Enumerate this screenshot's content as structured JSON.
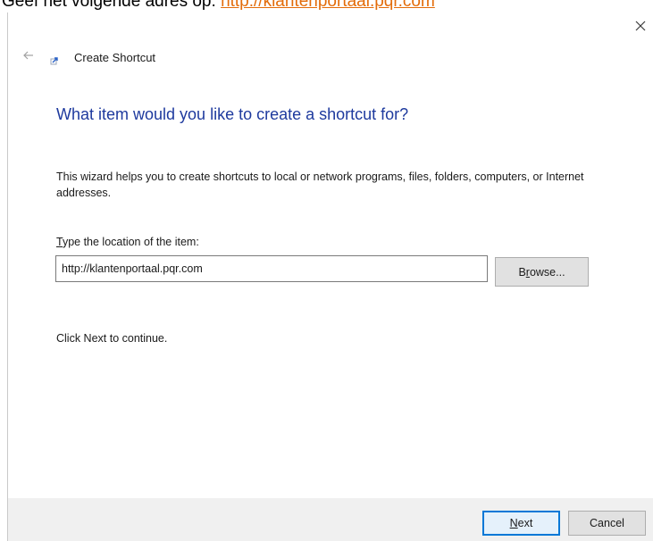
{
  "document": {
    "line_prefix": "Geef het volgende adres op: ",
    "line_link": "http://klantenportaal.pqr.com"
  },
  "dialog": {
    "title": "Create Shortcut",
    "close_glyph": "×",
    "back_glyph": "←",
    "heading": "What item would you like to create a shortcut for?",
    "description": "This wizard helps you to create shortcuts to local or network programs, files, folders, computers, or Internet addresses.",
    "location_label_accel": "T",
    "location_label_rest": "ype the location of the item:",
    "location_value": "http://klantenportaal.pqr.com",
    "browse_accel": "r",
    "browse_prefix": "B",
    "browse_suffix": "owse...",
    "continue_text": "Click Next to continue.",
    "next_accel": "N",
    "next_rest": "ext",
    "cancel_label": "Cancel"
  },
  "icons": {
    "close": "close-icon",
    "back": "back-arrow-icon",
    "shortcut": "shortcut-wizard-icon"
  },
  "colors": {
    "heading": "#1e3a9e",
    "link": "#e36c0a",
    "default_button_border": "#0078d7",
    "footer_background": "#f0f0f0"
  }
}
